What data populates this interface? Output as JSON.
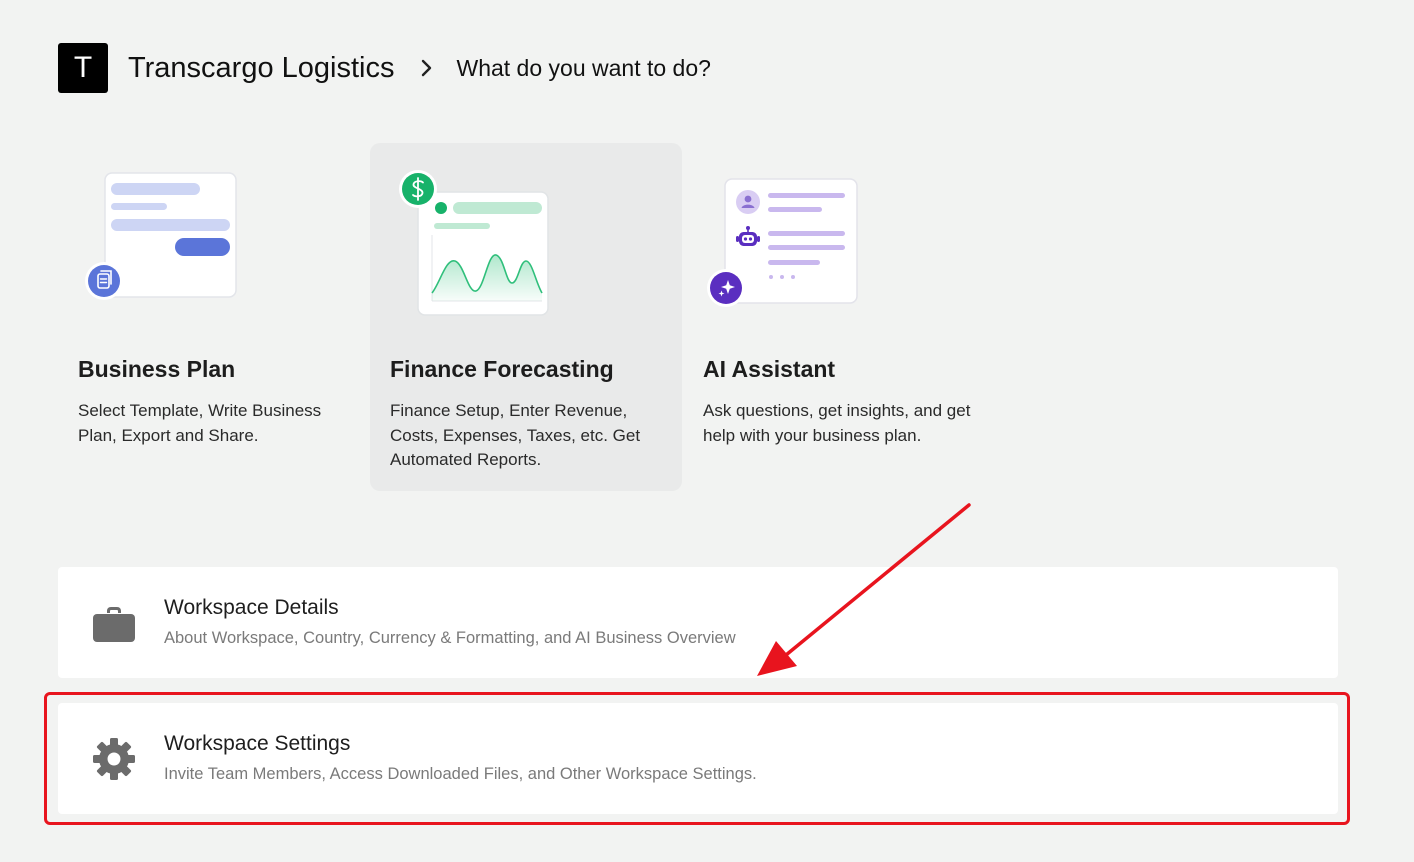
{
  "header": {
    "workspace_initial": "T",
    "workspace_name": "Transcargo Logistics",
    "page_title": "What do you want to do?"
  },
  "cards": [
    {
      "title": "Business Plan",
      "description": "Select Template, Write Business Plan, Export and Share."
    },
    {
      "title": "Finance Forecasting",
      "description": "Finance Setup, Enter Revenue, Costs, Expenses, Taxes, etc. Get Automated Reports."
    },
    {
      "title": "AI Assistant",
      "description": "Ask questions, get insights, and get help with your business plan."
    }
  ],
  "rows": [
    {
      "title": "Workspace Details",
      "subtitle": "About Workspace, Country, Currency & Formatting, and AI Business Overview",
      "icon": "briefcase-icon"
    },
    {
      "title": "Workspace Settings",
      "subtitle": "Invite Team Members, Access Downloaded Files, and Other Workspace Settings.",
      "icon": "gear-icon"
    }
  ],
  "colors": {
    "background": "#f2f3f2",
    "accent_blue": "#5b75d9",
    "accent_green": "#17b26a",
    "accent_purple": "#5a2ec0",
    "annotation_red": "#e8141e"
  }
}
